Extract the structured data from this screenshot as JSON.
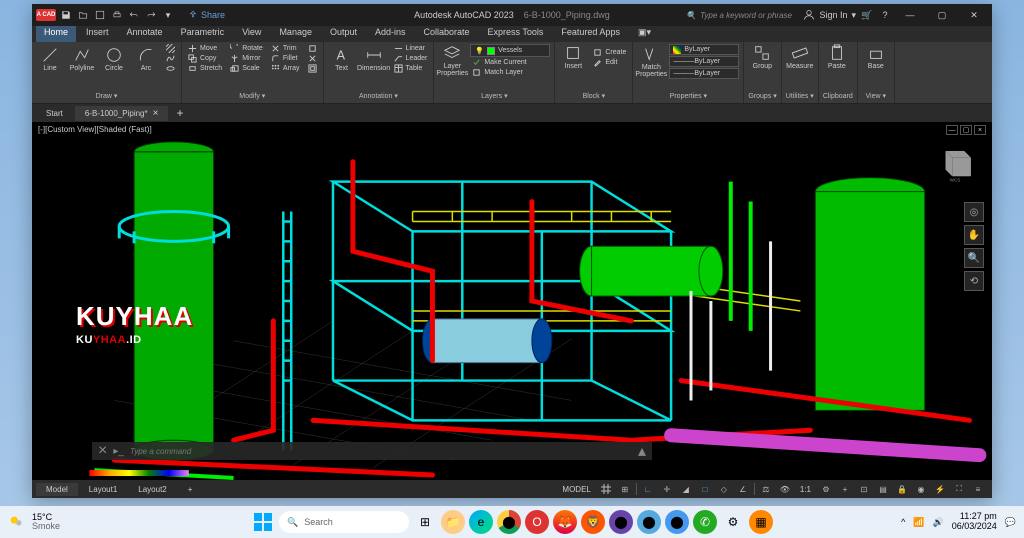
{
  "app": {
    "logo_text": "A CAD",
    "title": "Autodesk AutoCAD 2023",
    "filename": "6-B-1000_Piping.dwg",
    "share": "Share",
    "search_placeholder": "Type a keyword or phrase",
    "signin": "Sign In"
  },
  "menu": {
    "tabs": [
      "Home",
      "Insert",
      "Annotate",
      "Parametric",
      "View",
      "Manage",
      "Output",
      "Add-ins",
      "Collaborate",
      "Express Tools",
      "Featured Apps"
    ]
  },
  "ribbon": {
    "draw": {
      "label": "Draw ▾",
      "line": "Line",
      "polyline": "Polyline",
      "circle": "Circle",
      "arc": "Arc"
    },
    "modify": {
      "label": "Modify ▾",
      "move": "Move",
      "rotate": "Rotate",
      "trim": "Trim",
      "copy": "Copy",
      "mirror": "Mirror",
      "fillet": "Fillet",
      "stretch": "Stretch",
      "scale": "Scale",
      "array": "Array"
    },
    "annotation": {
      "label": "Annotation ▾",
      "text": "Text",
      "dimension": "Dimension",
      "linear": "Linear",
      "leader": "Leader",
      "table": "Table"
    },
    "layers": {
      "label": "Layers ▾",
      "props": "Layer\nProperties",
      "current": "Vessels",
      "makecurrent": "Make Current",
      "matchlayer": "Match Layer"
    },
    "block": {
      "label": "Block ▾",
      "insert": "Insert",
      "create": "Create",
      "edit": "Edit"
    },
    "properties": {
      "label": "Properties ▾",
      "match": "Match\nProperties",
      "bylayer1": "ByLayer",
      "bylayer2": "ByLayer",
      "bylayer3": "ByLayer"
    },
    "groups": {
      "label": "Groups ▾",
      "group": "Group"
    },
    "utilities": {
      "label": "Utilities ▾",
      "measure": "Measure"
    },
    "clipboard": {
      "label": "Clipboard",
      "paste": "Paste"
    },
    "view": {
      "label": "View ▾",
      "base": "Base"
    }
  },
  "docs": {
    "start": "Start",
    "active": "6-B-1000_Piping*"
  },
  "viewport": {
    "label": "[-][Custom View][Shaded (Fast)]",
    "wcs": "WCS"
  },
  "watermark": {
    "main": "KUYHAA",
    "ku": "KU",
    "yhaa": "YHAA",
    "id": ".ID"
  },
  "cmdline": {
    "placeholder": "Type a command"
  },
  "modeltabs": {
    "model": "Model",
    "layout1": "Layout1",
    "layout2": "Layout2"
  },
  "statusbar": {
    "model": "MODEL",
    "scale": "1:1"
  },
  "taskbar": {
    "temp": "15°C",
    "condition": "Smoke",
    "search": "Search",
    "time": "11:27 pm",
    "date": "06/03/2024"
  }
}
